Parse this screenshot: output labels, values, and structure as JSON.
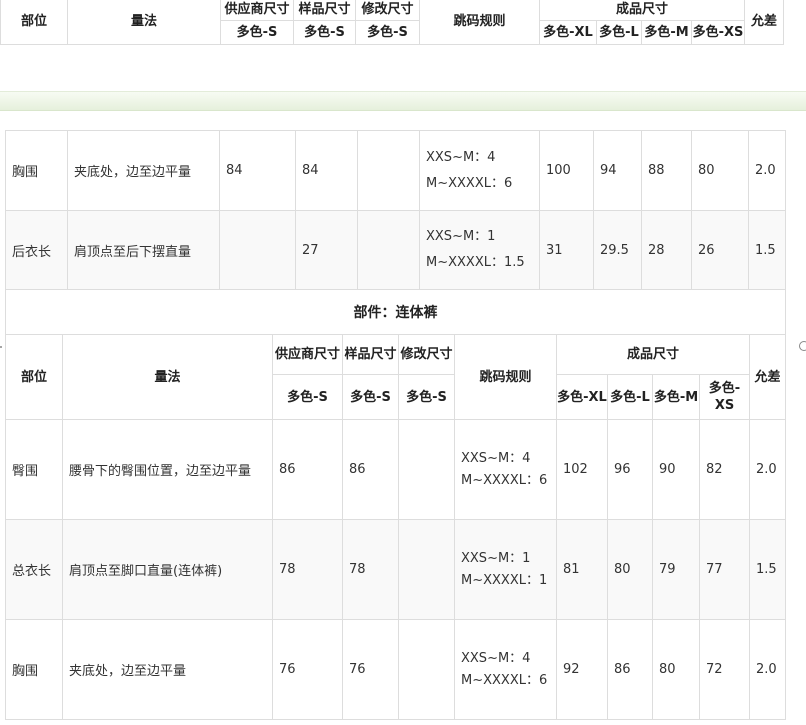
{
  "top_header": {
    "part": "部位",
    "method": "量法",
    "supplier_size": "供应商尺寸",
    "sample_size": "样品尺寸",
    "modify_size": "修改尺寸",
    "grade_rule": "跳码规则",
    "finished_size": "成品尺寸",
    "tolerance": "允差",
    "supplier_sub": "多色-S",
    "sample_sub": "多色-S",
    "modify_sub": "多色-S",
    "sizes": [
      "多色-XL",
      "多色-L",
      "多色-M",
      "多色-XS"
    ]
  },
  "upper_rows": [
    {
      "part": "胸围",
      "method": "夹底处，边至边平量",
      "supplier": "84",
      "sample": "84",
      "modify": "",
      "rule_line1": "XXS~M：4",
      "rule_line2": "M~XXXXL：6",
      "xl": "100",
      "l": "94",
      "m": "88",
      "xs": "80",
      "tol": "2.0"
    },
    {
      "part": "后衣长",
      "method": "肩顶点至后下摆直量",
      "supplier": "",
      "sample": "27",
      "modify": "",
      "rule_line1": "XXS~M：1",
      "rule_line2": "M~XXXXL：1.5",
      "xl": "31",
      "l": "29.5",
      "m": "28",
      "xs": "26",
      "tol": "1.5"
    }
  ],
  "section_title": "部件：连体裤",
  "lower_header": {
    "part": "部位",
    "method": "量法",
    "supplier_size": "供应商尺寸",
    "sample_size": "样品尺寸",
    "modify_size": "修改尺寸",
    "grade_rule": "跳码规则",
    "finished_size": "成品尺寸",
    "tolerance": "允差",
    "supplier_sub": "多色-S",
    "sample_sub": "多色-S",
    "modify_sub": "多色-S",
    "sizes": [
      "多色-XL",
      "多色-L",
      "多色-M",
      "多色-XS"
    ]
  },
  "lower_rows": [
    {
      "part": "臀围",
      "method": "腰骨下的臀围位置，边至边平量",
      "supplier": "86",
      "sample": "86",
      "modify": "",
      "rule_line1": "XXS~M：4",
      "rule_line2": "M~XXXXL：6",
      "xl": "102",
      "l": "96",
      "m": "90",
      "xs": "82",
      "tol": "2.0"
    },
    {
      "part": "总衣长",
      "method": "肩顶点至脚口直量(连体裤)",
      "supplier": "78",
      "sample": "78",
      "modify": "",
      "rule_line1": "XXS~M：1",
      "rule_line2": "M~XXXXL：1",
      "xl": "81",
      "l": "80",
      "m": "79",
      "xs": "77",
      "tol": "1.5"
    },
    {
      "part": "胸围",
      "method": "夹底处，边至边平量",
      "supplier": "76",
      "sample": "76",
      "modify": "",
      "rule_line1": "XXS~M：4",
      "rule_line2": "M~XXXXL：6",
      "xl": "92",
      "l": "86",
      "m": "80",
      "xs": "72",
      "tol": "2.0"
    }
  ],
  "colors": {
    "border": "#dddddd",
    "separator": "#e6f0dc",
    "alt_row": "#f9f9f9"
  }
}
